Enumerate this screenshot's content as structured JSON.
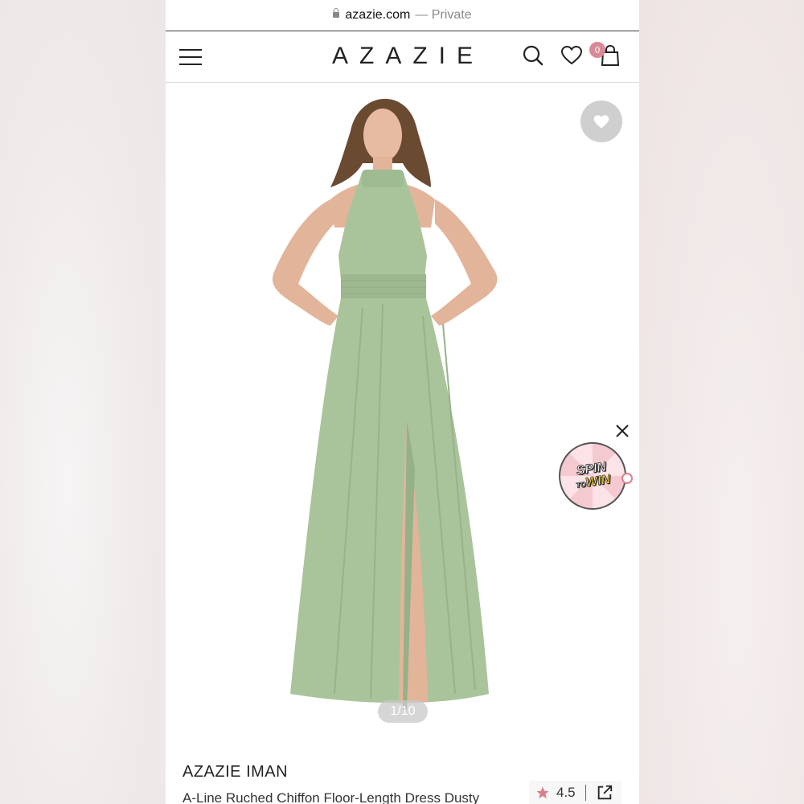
{
  "browser": {
    "domain": "azazie.com",
    "privacy": "— Private"
  },
  "header": {
    "logo": "AZAZIE",
    "bag_count": "0"
  },
  "gallery": {
    "counter": "1/10"
  },
  "promo": {
    "line1": "SPIN",
    "line2_small": "TO",
    "line2": "WIN"
  },
  "product": {
    "brand": "AZAZIE IMAN",
    "description": "A-Line Ruched Chiffon Floor-Length Dress Dusty",
    "rating": "4.5"
  },
  "colors": {
    "accent": "#d98a96",
    "dress": "#a9c49b"
  }
}
